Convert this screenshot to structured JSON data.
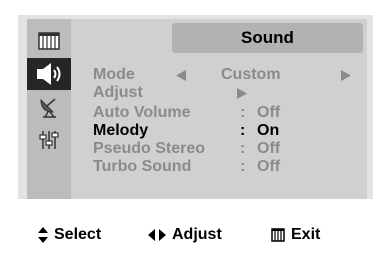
{
  "menu": {
    "title": "Sound",
    "tabs": [
      {
        "icon": "picture-icon",
        "active": false
      },
      {
        "icon": "speaker-icon",
        "active": true
      },
      {
        "icon": "satellite-dish-icon",
        "active": false
      },
      {
        "icon": "sliders-icon",
        "active": false
      }
    ],
    "items": [
      {
        "label": "Mode",
        "value": "Custom",
        "state": "dim"
      },
      {
        "label": "Adjust",
        "value": "",
        "state": "dim"
      },
      {
        "label": "Auto Volume",
        "colon": ":",
        "value": "Off",
        "state": "dim"
      },
      {
        "label": "Melody",
        "colon": ":",
        "value": "On",
        "state": "selected"
      },
      {
        "label": "Pseudo Stereo",
        "colon": ":",
        "value": "Off",
        "state": "dim"
      },
      {
        "label": "Turbo Sound",
        "colon": ":",
        "value": "Off",
        "state": "dim"
      }
    ]
  },
  "footer": {
    "select_label": "Select",
    "adjust_label": "Adjust",
    "exit_label": "Exit"
  },
  "colors": {
    "active_tab": "#262626",
    "dim_text": "#8b8b8b",
    "panel_bg": "#d0d0d0"
  }
}
